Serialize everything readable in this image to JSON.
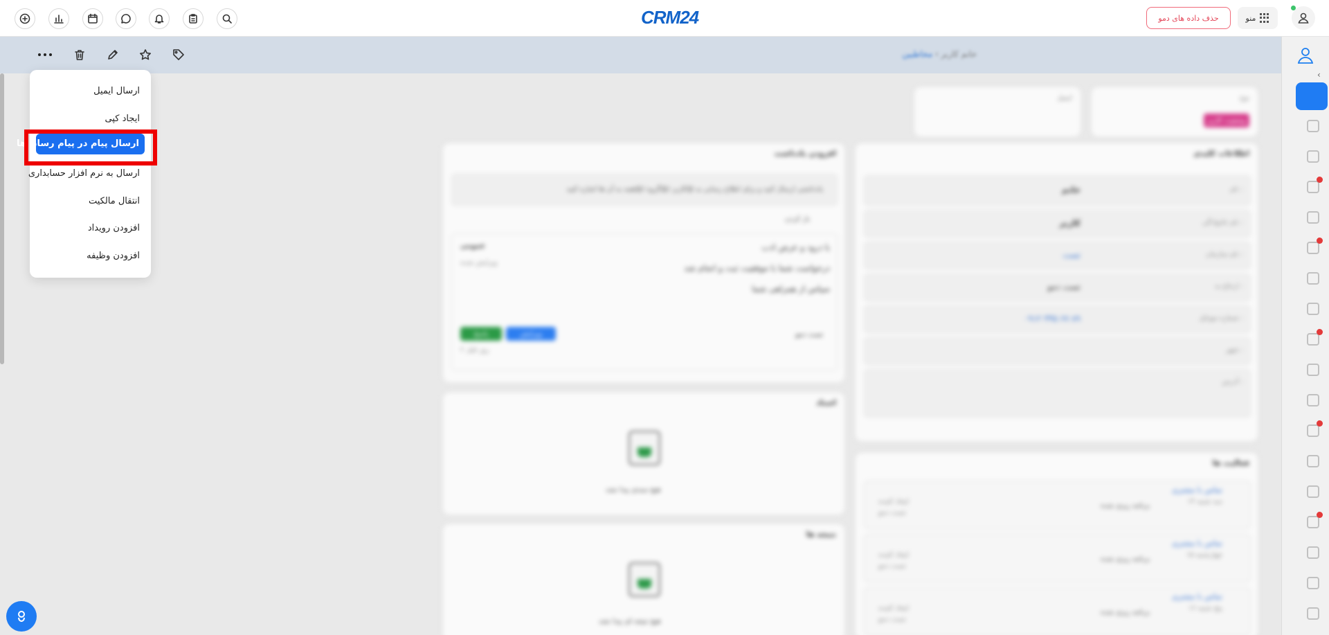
{
  "header": {
    "logo": "CRM24",
    "demo_button": "حذف داده های دمو",
    "menu_label": "منو"
  },
  "breadcrumb": {
    "parent": "مخاطبین",
    "separator": "›",
    "current": "خانم کاربر"
  },
  "dropdown": {
    "items": [
      "ارسال ایمیل",
      "ایجاد کپی",
      "ارسال پیام در پیام رسان ها",
      "ارسال به نرم افزار حسابداری",
      "انتقال مالکیت",
      "افزودن رویداد",
      "افزودن وظیفه"
    ],
    "selected_index": 2
  },
  "top_cards": {
    "status_label": "نوع",
    "status_value": "وضعیت کاربر",
    "email_label": "ایمیل"
  },
  "info_card": {
    "title": "اطلاعات کلیدی",
    "fields": [
      {
        "label": "نام :",
        "value": "خانم"
      },
      {
        "label": "نام خانوادگی :",
        "value": "کاربر"
      },
      {
        "label": "نام سازمان :",
        "value": "تست"
      },
      {
        "label": "ارجاع به :",
        "value": "تست دمو"
      },
      {
        "label": "شماره موبایل :",
        "value": "۰۹۱۲ ۳۴۵ ۶۷ ۸۹"
      },
      {
        "label": "شهر :",
        "value": ""
      },
      {
        "label": "آدرس :",
        "value": ""
      }
    ]
  },
  "note_card": {
    "title": "افزودن یادداشت",
    "placeholder": "یادداشتی ارسال کنید و برای اطلاع رسانی به @کاربر /@گروه /@همه به آن ها اشاره کنید",
    "toggle_label": "باز کردن",
    "note": {
      "line1": "با درود و عرض ادب",
      "line2": "درخواست شما با موفقیت ثبت و انجام شد",
      "line3": "سپاس از همراهی شما",
      "visibility": "عمومی",
      "edit_label": "ویرایش شده",
      "author": "تست دمو",
      "time": "۲ روز قبل",
      "edit_button": "ویرایش",
      "reply_button": "پاسخ"
    }
  },
  "docs_card": {
    "title": "اسناد",
    "empty": "هیچ سندی پیدا نشد"
  },
  "results_card": {
    "title": "نتیجه ها",
    "empty": "هیچ نتیجه ای پیدا نشد"
  },
  "activities_card": {
    "title": "فعالیت ها",
    "items": [
      {
        "title": "تماس با مشتری",
        "date": "سه شنبه ۱۴",
        "status": "برنامه ریزی شده",
        "creator": "ایجاد کننده",
        "creator_name": "تست دمو"
      },
      {
        "title": "تماس با مشتری",
        "date": "چهارشنبه ۱۵",
        "status": "برنامه ریزی شده",
        "creator": "ایجاد کننده",
        "creator_name": "تست دمو"
      },
      {
        "title": "تماس با مشتری",
        "date": "پنج شنبه ۱۶",
        "status": "برنامه ریزی شده",
        "creator": "ایجاد کننده",
        "creator_name": "تست دمو"
      }
    ]
  }
}
